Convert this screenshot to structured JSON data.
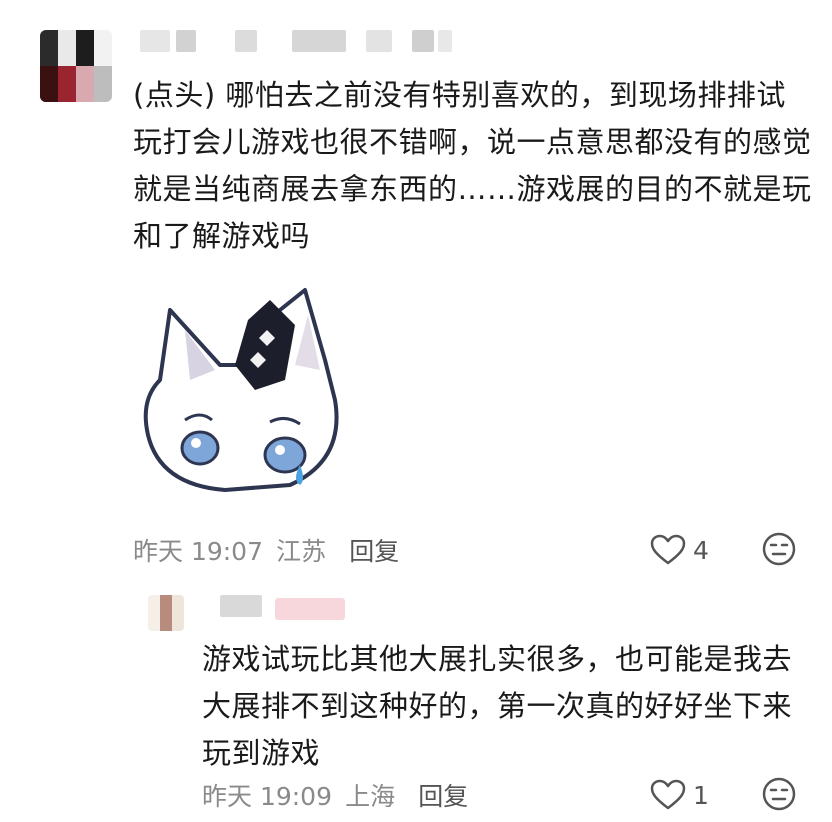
{
  "comment": {
    "text": "(点头) 哪怕去之前没有特别喜欢的，到现场排排试玩打会儿游戏也很不错啊，说一点意思都没有的感觉就是当纯商展去拿东西的……游戏展的目的不就是玩和了解游戏吗",
    "time": "昨天 19:07",
    "location": "江苏",
    "reply_label": "回复",
    "like_count": "4",
    "sticker_icon": "crying-fox-sticker"
  },
  "reply": {
    "text": "游戏试玩比其他大展扎实很多，也可能是我去大展排不到这种好的，第一次真的好好坐下来玩到游戏",
    "time": "昨天 19:09",
    "location": "上海",
    "reply_label": "回复",
    "like_count": "1"
  },
  "colors": {
    "meta_gray": "#8a8a8a",
    "text": "#1a1a1a",
    "icon_gray": "#555555"
  }
}
